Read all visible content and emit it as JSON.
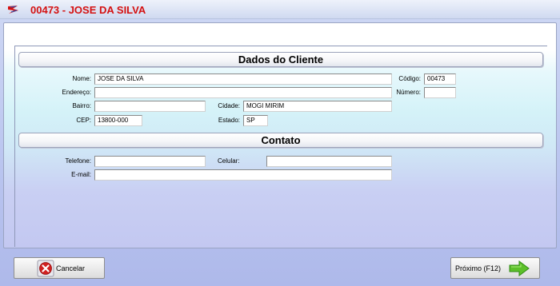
{
  "window": {
    "title": "00473 - JOSE DA SILVA",
    "app_icon": "scissors-logo-icon",
    "accent_color": "#d41010"
  },
  "client_section": {
    "title": "Dados do Cliente",
    "fields": {
      "nome": {
        "label": "Nome:",
        "value": "JOSE DA SILVA"
      },
      "codigo": {
        "label": "Código:",
        "value": "00473"
      },
      "endereco": {
        "label": "Endereço:",
        "value": ""
      },
      "numero": {
        "label": "Número:",
        "value": ""
      },
      "bairro": {
        "label": "Bairro:",
        "value": ""
      },
      "cidade": {
        "label": "Cidade:",
        "value": "MOGI MIRIM"
      },
      "cep": {
        "label": "CEP:",
        "value": "13800-000"
      },
      "estado": {
        "label": "Estado:",
        "value": "SP"
      }
    }
  },
  "contact_section": {
    "title": "Contato",
    "fields": {
      "telefone": {
        "label": "Telefone:",
        "value": ""
      },
      "celular": {
        "label": "Celular:",
        "value": ""
      },
      "email": {
        "label": "E-mail:",
        "value": ""
      }
    }
  },
  "buttons": {
    "cancel": {
      "label": "Cancelar",
      "icon": "red-x-icon"
    },
    "next": {
      "label": "Próximo (F12)",
      "icon": "green-arrow-right-icon"
    }
  }
}
